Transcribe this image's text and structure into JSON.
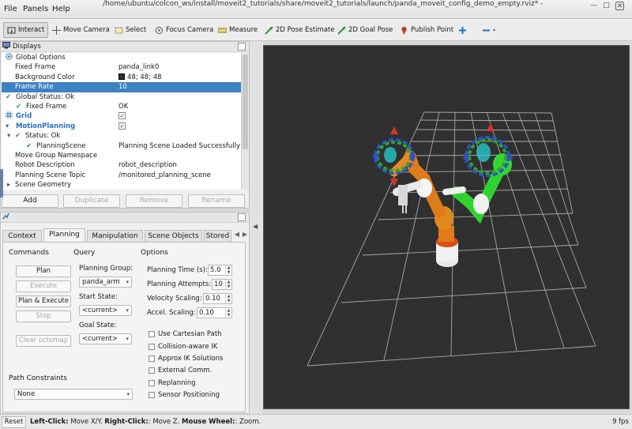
{
  "window": {
    "title": "/home/ubuntu/colcon_ws/install/moveit2_tutorials/share/moveit2_tutorials/launch/panda_moveit_config_demo_empty.rviz* - RViz"
  },
  "menu": [
    "File",
    "Panels",
    "Help"
  ],
  "toolbar": {
    "tools": [
      "Interact",
      "Move Camera",
      "Select",
      "Focus Camera",
      "Measure",
      "2D Pose Estimate",
      "2D Goal Pose",
      "Publish Point"
    ],
    "active": "Interact"
  },
  "displays": {
    "title": "Displays",
    "rows": [
      {
        "label": "Global Options",
        "value": ""
      },
      {
        "label": "Fixed Frame",
        "value": "panda_link0"
      },
      {
        "label": "Background Color",
        "value": "48; 48; 48"
      },
      {
        "label": "Frame Rate",
        "value": "10"
      },
      {
        "label": "Global Status: Ok",
        "value": ""
      },
      {
        "label": "Fixed Frame",
        "value": "OK"
      },
      {
        "label": "Grid",
        "value": ""
      },
      {
        "label": "MotionPlanning",
        "value": ""
      },
      {
        "label": "Status: Ok",
        "value": ""
      },
      {
        "label": "PlanningScene",
        "value": "Planning Scene Loaded Successfully"
      },
      {
        "label": "Move Group Namespace",
        "value": ""
      },
      {
        "label": "Robot Description",
        "value": "robot_description"
      },
      {
        "label": "Planning Scene Topic",
        "value": "/monitored_planning_scene"
      },
      {
        "label": "Scene Geometry",
        "value": ""
      }
    ],
    "buttons": [
      "Add",
      "Duplicate",
      "Remove",
      "Rename"
    ]
  },
  "motion_planning": {
    "tabs": [
      "Context",
      "Planning",
      "Manipulation",
      "Scene Objects",
      "Stored"
    ],
    "active_tab": "Planning",
    "commands": {
      "title": "Commands",
      "buttons": [
        "Plan",
        "Execute",
        "Plan & Execute",
        "Stop",
        "Clear octomap"
      ]
    },
    "query": {
      "title": "Query",
      "planning_group_label": "Planning Group:",
      "planning_group": "panda_arm",
      "start_state_label": "Start State:",
      "start_state": "<current>",
      "goal_state_label": "Goal State:",
      "goal_state": "<current>"
    },
    "options": {
      "title": "Options",
      "planning_time_label": "Planning Time (s):",
      "planning_time": "5.0",
      "planning_attempts_label": "Planning Attempts:",
      "planning_attempts": "10",
      "velocity_scaling_label": "Velocity Scaling:",
      "velocity_scaling": "0.10",
      "accel_scaling_label": "Accel. Scaling:",
      "accel_scaling": "0.10",
      "checkboxes": [
        "Use Cartesian Path",
        "Collision-aware IK",
        "Approx IK Solutions",
        "External Comm.",
        "Replanning",
        "Sensor Positioning"
      ]
    },
    "path_constraints": {
      "title": "Path Constraints",
      "value": "None"
    }
  },
  "status": {
    "reset": "Reset",
    "help_bold1": "Left-Click:",
    "help_text1": " Move X/Y. ",
    "help_bold2": "Right-Click:",
    "help_text2": ": Move Z. ",
    "help_bold3": "Mouse Wheel:",
    "help_text3": ": Zoom.",
    "fps": "9 fps"
  },
  "colors": {
    "selection": "#3d83c2",
    "viewport_bg": "#303030",
    "robot_orange": "#e07b1a",
    "robot_green": "#2fd32f"
  }
}
